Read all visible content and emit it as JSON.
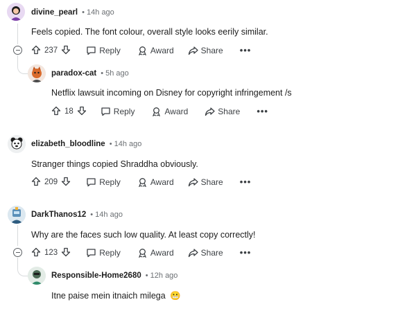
{
  "actions": {
    "reply": "Reply",
    "award": "Award",
    "share": "Share",
    "more": "•••"
  },
  "comments": [
    {
      "user": "divine_pearl",
      "time": "• 14h ago",
      "text": "Feels copied. The font colour, overall style looks eerily similar.",
      "votes": "237"
    },
    {
      "user": "paradox-cat",
      "time": "• 5h ago",
      "text": "Netflix lawsuit incoming on Disney for copyright infringement /s",
      "votes": "18"
    },
    {
      "user": "elizabeth_bloodline",
      "time": "• 14h ago",
      "text": "Stranger things copied Shraddha obviously.",
      "votes": "209"
    },
    {
      "user": "DarkThanos12",
      "time": "• 14h ago",
      "text": "Why are the faces such low quality. At least copy correctly!",
      "votes": "123"
    },
    {
      "user": "Responsible-Home2680",
      "time": "• 12h ago",
      "text": "Itne paise mein itnaich milega",
      "emoji": "😬"
    }
  ],
  "colors": {
    "text": "#1c1c1c",
    "meta": "#6b6f73",
    "icon": "#3b3f43",
    "thread": "#d7dadc"
  }
}
